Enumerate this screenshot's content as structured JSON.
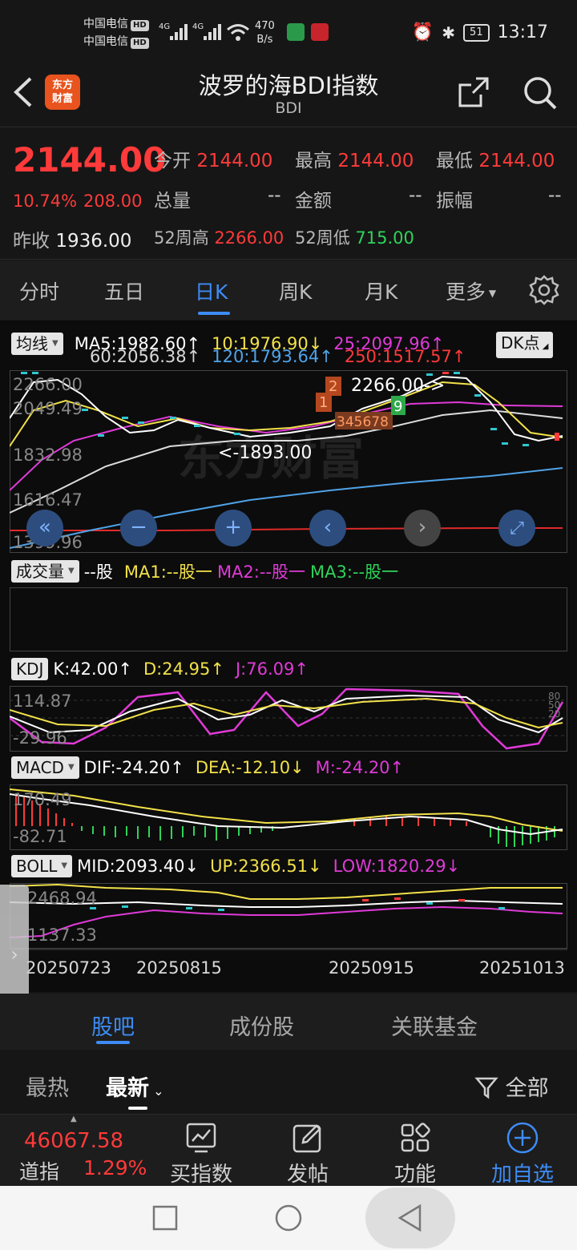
{
  "status_bar": {
    "carrier_1": "中国电信",
    "carrier_2": "中国电信",
    "hd": "HD",
    "net_1": "4G",
    "net_2": "4G",
    "speed_value": "470",
    "speed_unit": "B/s",
    "battery": "51",
    "time": "13:17"
  },
  "header": {
    "logo_line1": "东方",
    "logo_line2": "财富",
    "title": "波罗的海BDI指数",
    "subtitle": "BDI"
  },
  "quote": {
    "price": "2144.00",
    "change_pct": "10.74%",
    "change_abs": "208.00",
    "open_label": "今开",
    "open": "2144.00",
    "high_label": "最高",
    "high": "2144.00",
    "low_label": "最低",
    "low": "2144.00",
    "volume_label": "总量",
    "volume": "--",
    "amount_label": "金额",
    "amount": "--",
    "amplitude_label": "振幅",
    "amplitude": "--",
    "prev_close_label": "昨收",
    "prev_close": "1936.00",
    "w52_high_label": "52周高",
    "w52_high": "2266.00",
    "w52_low_label": "52周低",
    "w52_low": "715.00"
  },
  "period_tabs": {
    "intraday": "分时",
    "five_day": "五日",
    "daily": "日K",
    "weekly": "周K",
    "monthly": "月K",
    "more": "更多"
  },
  "ma_legend": {
    "selector": "均线",
    "ma5": "MA5:1982.60↑",
    "ma10": "10:1976.90↓",
    "ma25": "25:2097.96↑",
    "ma60": "60:2056.38↑",
    "ma120": "120:1793.64↑",
    "ma250": "250:1517.57↑",
    "dk_button": "DK点"
  },
  "main_chart": {
    "axis_labels": [
      "2266.00",
      "2049.49",
      "1832.98",
      "1616.47",
      "1399.96"
    ],
    "high_marker": "2266.00->",
    "low_marker": "<-1893.00",
    "watermark": "东方财富",
    "td_counts_a": [
      "1",
      "2"
    ],
    "td_counts_b": "345678",
    "td_count_9": "9"
  },
  "volume_legend": {
    "selector": "成交量",
    "value": "--股",
    "ma1": "MA1:--股一",
    "ma2": "MA2:--股一",
    "ma3": "MA3:--股一"
  },
  "kdj": {
    "selector": "KDJ",
    "k": "K:42.00↑",
    "d": "D:24.95↑",
    "j": "J:76.09↑",
    "axis_top": "114.87",
    "axis_bottom": "-29.96",
    "right_marks": [
      "80",
      "50",
      "20"
    ]
  },
  "macd": {
    "selector": "MACD",
    "dif": "DIF:-24.20↑",
    "dea": "DEA:-12.10↓",
    "m": "M:-24.20↑",
    "axis_top": "170.49",
    "axis_bottom": "-82.71"
  },
  "boll": {
    "selector": "BOLL",
    "mid": "MID:2093.40↓",
    "up": "UP:2366.51↓",
    "low": "LOW:1820.29↓",
    "axis_top": "2468.94",
    "axis_bottom": "1137.33"
  },
  "dates": [
    "20250723",
    "20250815",
    "20250915",
    "20251013"
  ],
  "content_tabs": {
    "guba": "股吧",
    "constituents": "成份股",
    "related_funds": "关联基金"
  },
  "filter": {
    "hottest": "最热",
    "latest": "最新",
    "all": "全部"
  },
  "bottom_bar": {
    "dow_value": "46067.58",
    "dow_label": "道指",
    "dow_pct": "1.29%",
    "buy_index": "买指数",
    "post": "发帖",
    "functions": "功能",
    "add_watch": "加自选"
  },
  "colors": {
    "up_red": "#ff3a3a",
    "down_green": "#2ed35a",
    "accent_blue": "#3d8cf5",
    "ma5": "#ffffff",
    "ma10": "#f2e14a",
    "ma25": "#e03ad8",
    "ma60": "#d8d8d8",
    "ma120": "#4fa3e8",
    "ma250": "#e02a2a"
  }
}
